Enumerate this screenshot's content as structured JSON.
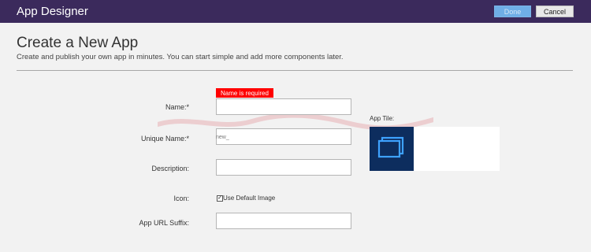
{
  "app": {
    "title": "App Designer"
  },
  "toolbar": {
    "done_label": "Done",
    "cancel_label": "Cancel"
  },
  "page": {
    "title": "Create a New App",
    "subtitle": "Create and publish your own app in minutes. You can start simple and add more components later."
  },
  "form": {
    "name": {
      "label": "Name:*",
      "value": "",
      "error": "Name is required"
    },
    "unique_name": {
      "label": "Unique Name:*",
      "value": "new_"
    },
    "description": {
      "label": "Description:",
      "value": ""
    },
    "icon": {
      "label": "Icon:",
      "checkbox_label": "Use Default Image",
      "checked": true
    },
    "url_suffix": {
      "label": "App URL Suffix:",
      "value": ""
    }
  },
  "tile": {
    "label": "App Tile:",
    "icon": "app-tile-icon"
  },
  "colors": {
    "header": "#3b2a5c",
    "done": "#6faee6",
    "error": "#ff0000",
    "tile_bg": "#0d2d5e"
  }
}
